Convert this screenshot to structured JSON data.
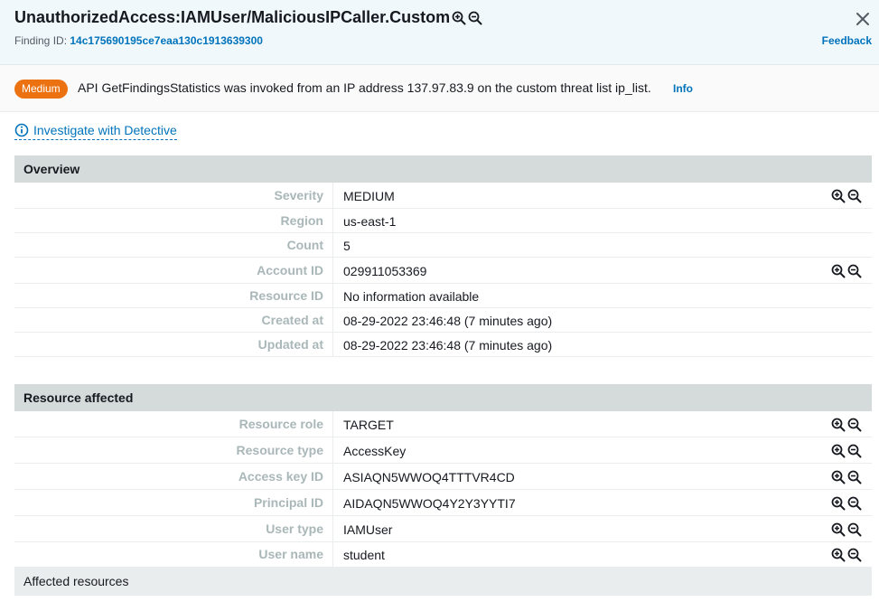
{
  "header": {
    "title": "UnauthorizedAccess:IAMUser/MaliciousIPCaller.Custom",
    "finding_id_label": "Finding ID:",
    "finding_id": "14c175690195ce7eaa130c1913639300",
    "feedback": "Feedback"
  },
  "summary": {
    "severity_badge": "Medium",
    "text": "API GetFindingsStatistics was invoked from an IP address 137.97.83.9 on the custom threat list ip_list.",
    "info": "Info"
  },
  "investigate": "Investigate with Detective",
  "overview": {
    "title": "Overview",
    "rows": [
      {
        "label": "Severity",
        "value": "MEDIUM"
      },
      {
        "label": "Region",
        "value": "us-east-1"
      },
      {
        "label": "Count",
        "value": "5"
      },
      {
        "label": "Account ID",
        "value": "029911053369"
      },
      {
        "label": "Resource ID",
        "value": "No information available"
      },
      {
        "label": "Created at",
        "value": "08-29-2022 23:46:48 (7 minutes ago)"
      },
      {
        "label": "Updated at",
        "value": "08-29-2022 23:46:48 (7 minutes ago)"
      }
    ]
  },
  "resource": {
    "title": "Resource affected",
    "rows": [
      {
        "label": "Resource role",
        "value": "TARGET"
      },
      {
        "label": "Resource type",
        "value": "AccessKey"
      },
      {
        "label": "Access key ID",
        "value": "ASIAQN5WWOQ4TTTVR4CD"
      },
      {
        "label": "Principal ID",
        "value": "AIDAQN5WWOQ4Y2Y3YYTI7"
      },
      {
        "label": "User type",
        "value": "IAMUser"
      },
      {
        "label": "User name",
        "value": "student"
      }
    ]
  },
  "affected_resources": "Affected resources",
  "colors": {
    "accent": "#0073bb",
    "severity_medium": "#ec7211",
    "section_bg": "#d5dbdb"
  }
}
